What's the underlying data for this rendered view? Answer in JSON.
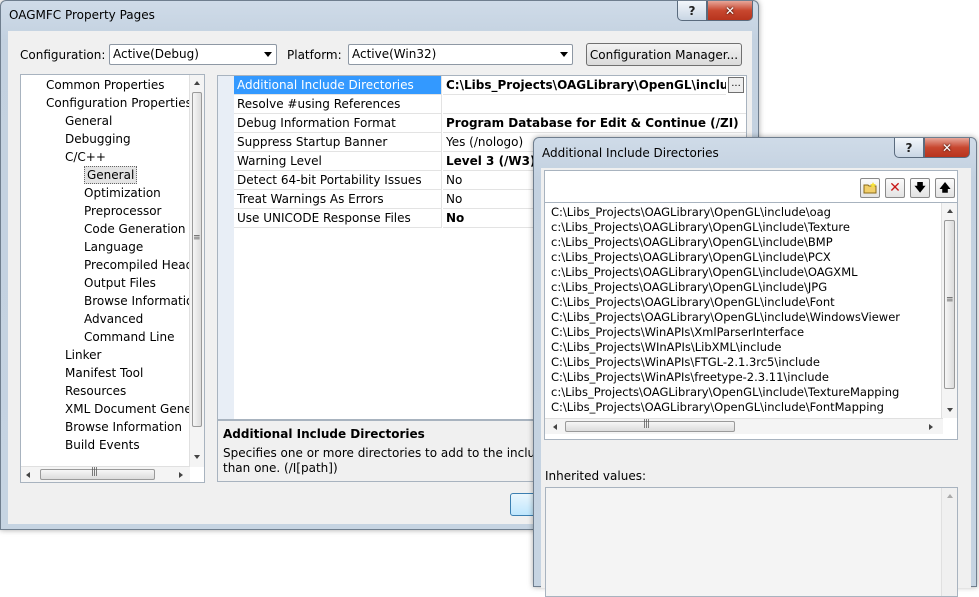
{
  "main_window": {
    "title": "OAGMFC Property Pages",
    "help_label": "?",
    "close_label": "✕",
    "configuration_label": "Configuration:",
    "configuration_value": "Active(Debug)",
    "platform_label": "Platform:",
    "platform_value": "Active(Win32)",
    "config_manager_label": "Configuration Manager..."
  },
  "tree": {
    "items": [
      {
        "label": "Common Properties",
        "level": 0
      },
      {
        "label": "Configuration Properties",
        "level": 0
      },
      {
        "label": "General",
        "level": 1
      },
      {
        "label": "Debugging",
        "level": 1
      },
      {
        "label": "C/C++",
        "level": 1
      },
      {
        "label": "General",
        "level": 2,
        "selected": true
      },
      {
        "label": "Optimization",
        "level": 2
      },
      {
        "label": "Preprocessor",
        "level": 2
      },
      {
        "label": "Code Generation",
        "level": 2
      },
      {
        "label": "Language",
        "level": 2
      },
      {
        "label": "Precompiled Heade",
        "level": 2
      },
      {
        "label": "Output Files",
        "level": 2
      },
      {
        "label": "Browse Information",
        "level": 2
      },
      {
        "label": "Advanced",
        "level": 2
      },
      {
        "label": "Command Line",
        "level": 2
      },
      {
        "label": "Linker",
        "level": 1
      },
      {
        "label": "Manifest Tool",
        "level": 1
      },
      {
        "label": "Resources",
        "level": 1
      },
      {
        "label": "XML Document Genera",
        "level": 1
      },
      {
        "label": "Browse Information",
        "level": 1
      },
      {
        "label": "Build Events",
        "level": 1
      }
    ]
  },
  "properties": {
    "rows": [
      {
        "name": "Additional Include Directories",
        "value": "C:\\Libs_Projects\\OAGLibrary\\OpenGL\\include\\oag;",
        "bold": true,
        "selected": true
      },
      {
        "name": "Resolve #using References",
        "value": "",
        "bold": false
      },
      {
        "name": "Debug Information Format",
        "value": "Program Database for Edit & Continue (/ZI)",
        "bold": true
      },
      {
        "name": "Suppress Startup Banner",
        "value": "Yes (/nologo)",
        "bold": false
      },
      {
        "name": "Warning Level",
        "value": "Level 3 (/W3)",
        "bold": true
      },
      {
        "name": "Detect 64-bit Portability Issues",
        "value": "No",
        "bold": false
      },
      {
        "name": "Treat Warnings As Errors",
        "value": "No",
        "bold": false
      },
      {
        "name": "Use UNICODE Response Files",
        "value": "No",
        "bold": true
      }
    ],
    "ellipsis_label": "...",
    "description_title": "Additional Include Directories",
    "description_line1": "Specifies one or more directories to add to the include path",
    "description_line2": "than one.     (/I[path])"
  },
  "dialog": {
    "title": "Additional Include Directories",
    "help_label": "?",
    "close_label": "✕",
    "tools": [
      "new-folder-icon",
      "delete-icon",
      "move-down-icon",
      "move-up-icon"
    ],
    "entries": [
      "C:\\Libs_Projects\\OAGLibrary\\OpenGL\\include\\oag",
      "c:\\Libs_Projects\\OAGLibrary\\OpenGL\\include\\Texture",
      "c:\\Libs_Projects\\OAGLibrary\\OpenGL\\include\\BMP",
      "c:\\Libs_Projects\\OAGLibrary\\OpenGL\\include\\PCX",
      "c:\\Libs_Projects\\OAGLibrary\\OpenGL\\include\\OAGXML",
      "c:\\Libs_Projects\\OAGLibrary\\OpenGL\\include\\JPG",
      "C:\\Libs_Projects\\OAGLibrary\\OpenGL\\include\\Font",
      "C:\\Libs_Projects\\OAGLibrary\\OpenGL\\include\\WindowsViewer",
      "C:\\Libs_Projects\\WinAPIs\\XmlParserInterface",
      "C:\\Libs_Projects\\WInAPIs\\LibXML\\include",
      "C:\\Libs_Projects\\WinAPIs\\FTGL-2.1.3rc5\\include",
      "C:\\Libs_Projects\\WinAPIs\\freetype-2.3.11\\include",
      "c:\\Libs_Projects\\OAGLibrary\\OpenGL\\include\\TextureMapping",
      "C:\\Libs_Projects\\OAGLibrary\\OpenGL\\include\\FontMapping"
    ],
    "inherited_label": "Inherited values:"
  }
}
